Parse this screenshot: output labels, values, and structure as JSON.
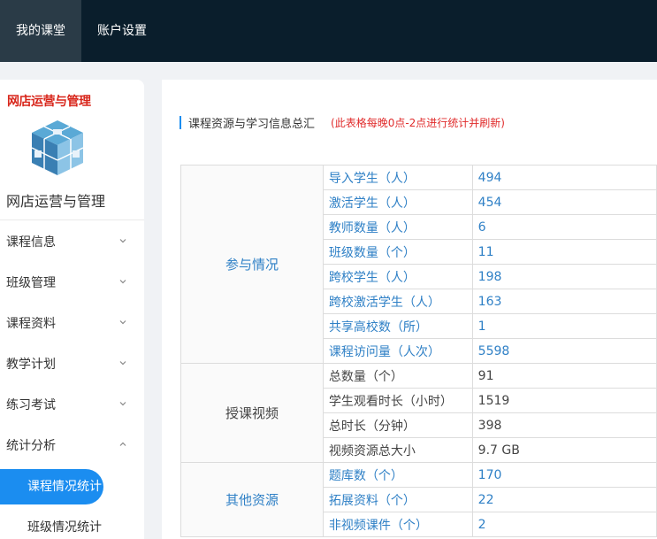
{
  "topnav": {
    "items": [
      {
        "label": "我的课堂",
        "active": true
      },
      {
        "label": "账户设置",
        "active": false
      }
    ],
    "background": "#0a1e2c"
  },
  "sidebar": {
    "logo_text": "网店运营与管理",
    "course_name": "网店运营与管理",
    "menu": [
      {
        "label": "课程信息",
        "expanded": false
      },
      {
        "label": "班级管理",
        "expanded": false
      },
      {
        "label": "课程资料",
        "expanded": false
      },
      {
        "label": "教学计划",
        "expanded": false
      },
      {
        "label": "练习考试",
        "expanded": false
      },
      {
        "label": "统计分析",
        "expanded": true
      }
    ],
    "sub_items": [
      {
        "label": "课程情况统计",
        "active": true
      },
      {
        "label": "班级情况统计",
        "active": false
      }
    ]
  },
  "main": {
    "section_title": "课程资源与学习信息总汇",
    "section_note": "(此表格每晚0点-2点进行统计并刷新)",
    "groups": [
      {
        "category": "参与情况",
        "color": "blue",
        "rows": [
          {
            "label": "导入学生（人）",
            "value": "494"
          },
          {
            "label": "激活学生（人）",
            "value": "454"
          },
          {
            "label": "教师数量（人）",
            "value": "6"
          },
          {
            "label": "班级数量（个）",
            "value": "11"
          },
          {
            "label": "跨校学生（人）",
            "value": "198"
          },
          {
            "label": "跨校激活学生（人）",
            "value": "163"
          },
          {
            "label": "共享高校数（所）",
            "value": "1"
          },
          {
            "label": "课程访问量（人次）",
            "value": "5598"
          }
        ]
      },
      {
        "category": "授课视频",
        "color": "gray",
        "rows": [
          {
            "label": "总数量（个）",
            "value": "91"
          },
          {
            "label": "学生观看时长（小时）",
            "value": "1519"
          },
          {
            "label": "总时长（分钟）",
            "value": "398"
          },
          {
            "label": "视频资源总大小",
            "value": "9.7 GB"
          }
        ]
      },
      {
        "category": "其他资源",
        "color": "blue",
        "rows": [
          {
            "label": "题库数（个）",
            "value": "170"
          },
          {
            "label": "拓展资料（个）",
            "value": "22"
          },
          {
            "label": "非视频课件（个）",
            "value": "2"
          }
        ]
      }
    ]
  },
  "colors": {
    "accent": "#1b8df0",
    "link_blue": "#2f80c6",
    "note_red": "#e02b2b"
  }
}
